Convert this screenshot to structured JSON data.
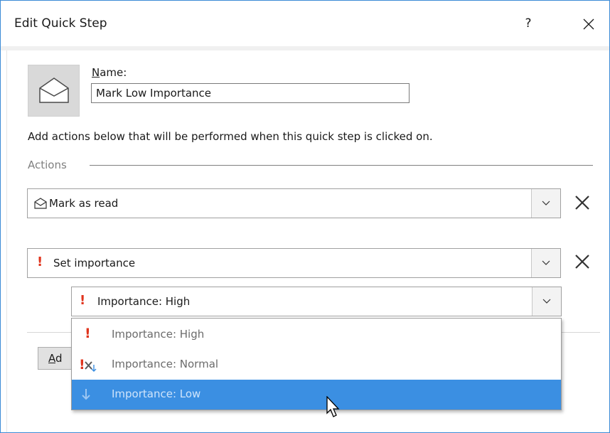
{
  "dialog": {
    "title": "Edit Quick Step",
    "help_label": "?"
  },
  "name_field": {
    "label_accel": "N",
    "label_rest": "ame:",
    "value": "Mark Low Importance"
  },
  "description": "Add actions below that will be performed when this quick step is clicked on.",
  "actions_group": {
    "label": "Actions",
    "items": [
      {
        "label": "Mark as read",
        "icon": "envelope-open-icon"
      },
      {
        "label": "Set importance",
        "icon": "exclamation-icon",
        "sub_value": "Importance: High",
        "sub_icon": "exclamation-icon"
      }
    ]
  },
  "add_action_button": {
    "label_accel": "A",
    "label_rest": "d"
  },
  "importance_dropdown": {
    "options": [
      {
        "label": "Importance: High",
        "icon": "exclamation-icon"
      },
      {
        "label": "Importance: Normal",
        "icon": "exclamation-x-icon"
      },
      {
        "label": "Importance: Low",
        "icon": "arrow-down-icon"
      }
    ],
    "selected_index": 2
  },
  "colors": {
    "accent": "#3b8fe2",
    "importance_red": "#e0341d",
    "window_border": "#3c8bd6"
  }
}
